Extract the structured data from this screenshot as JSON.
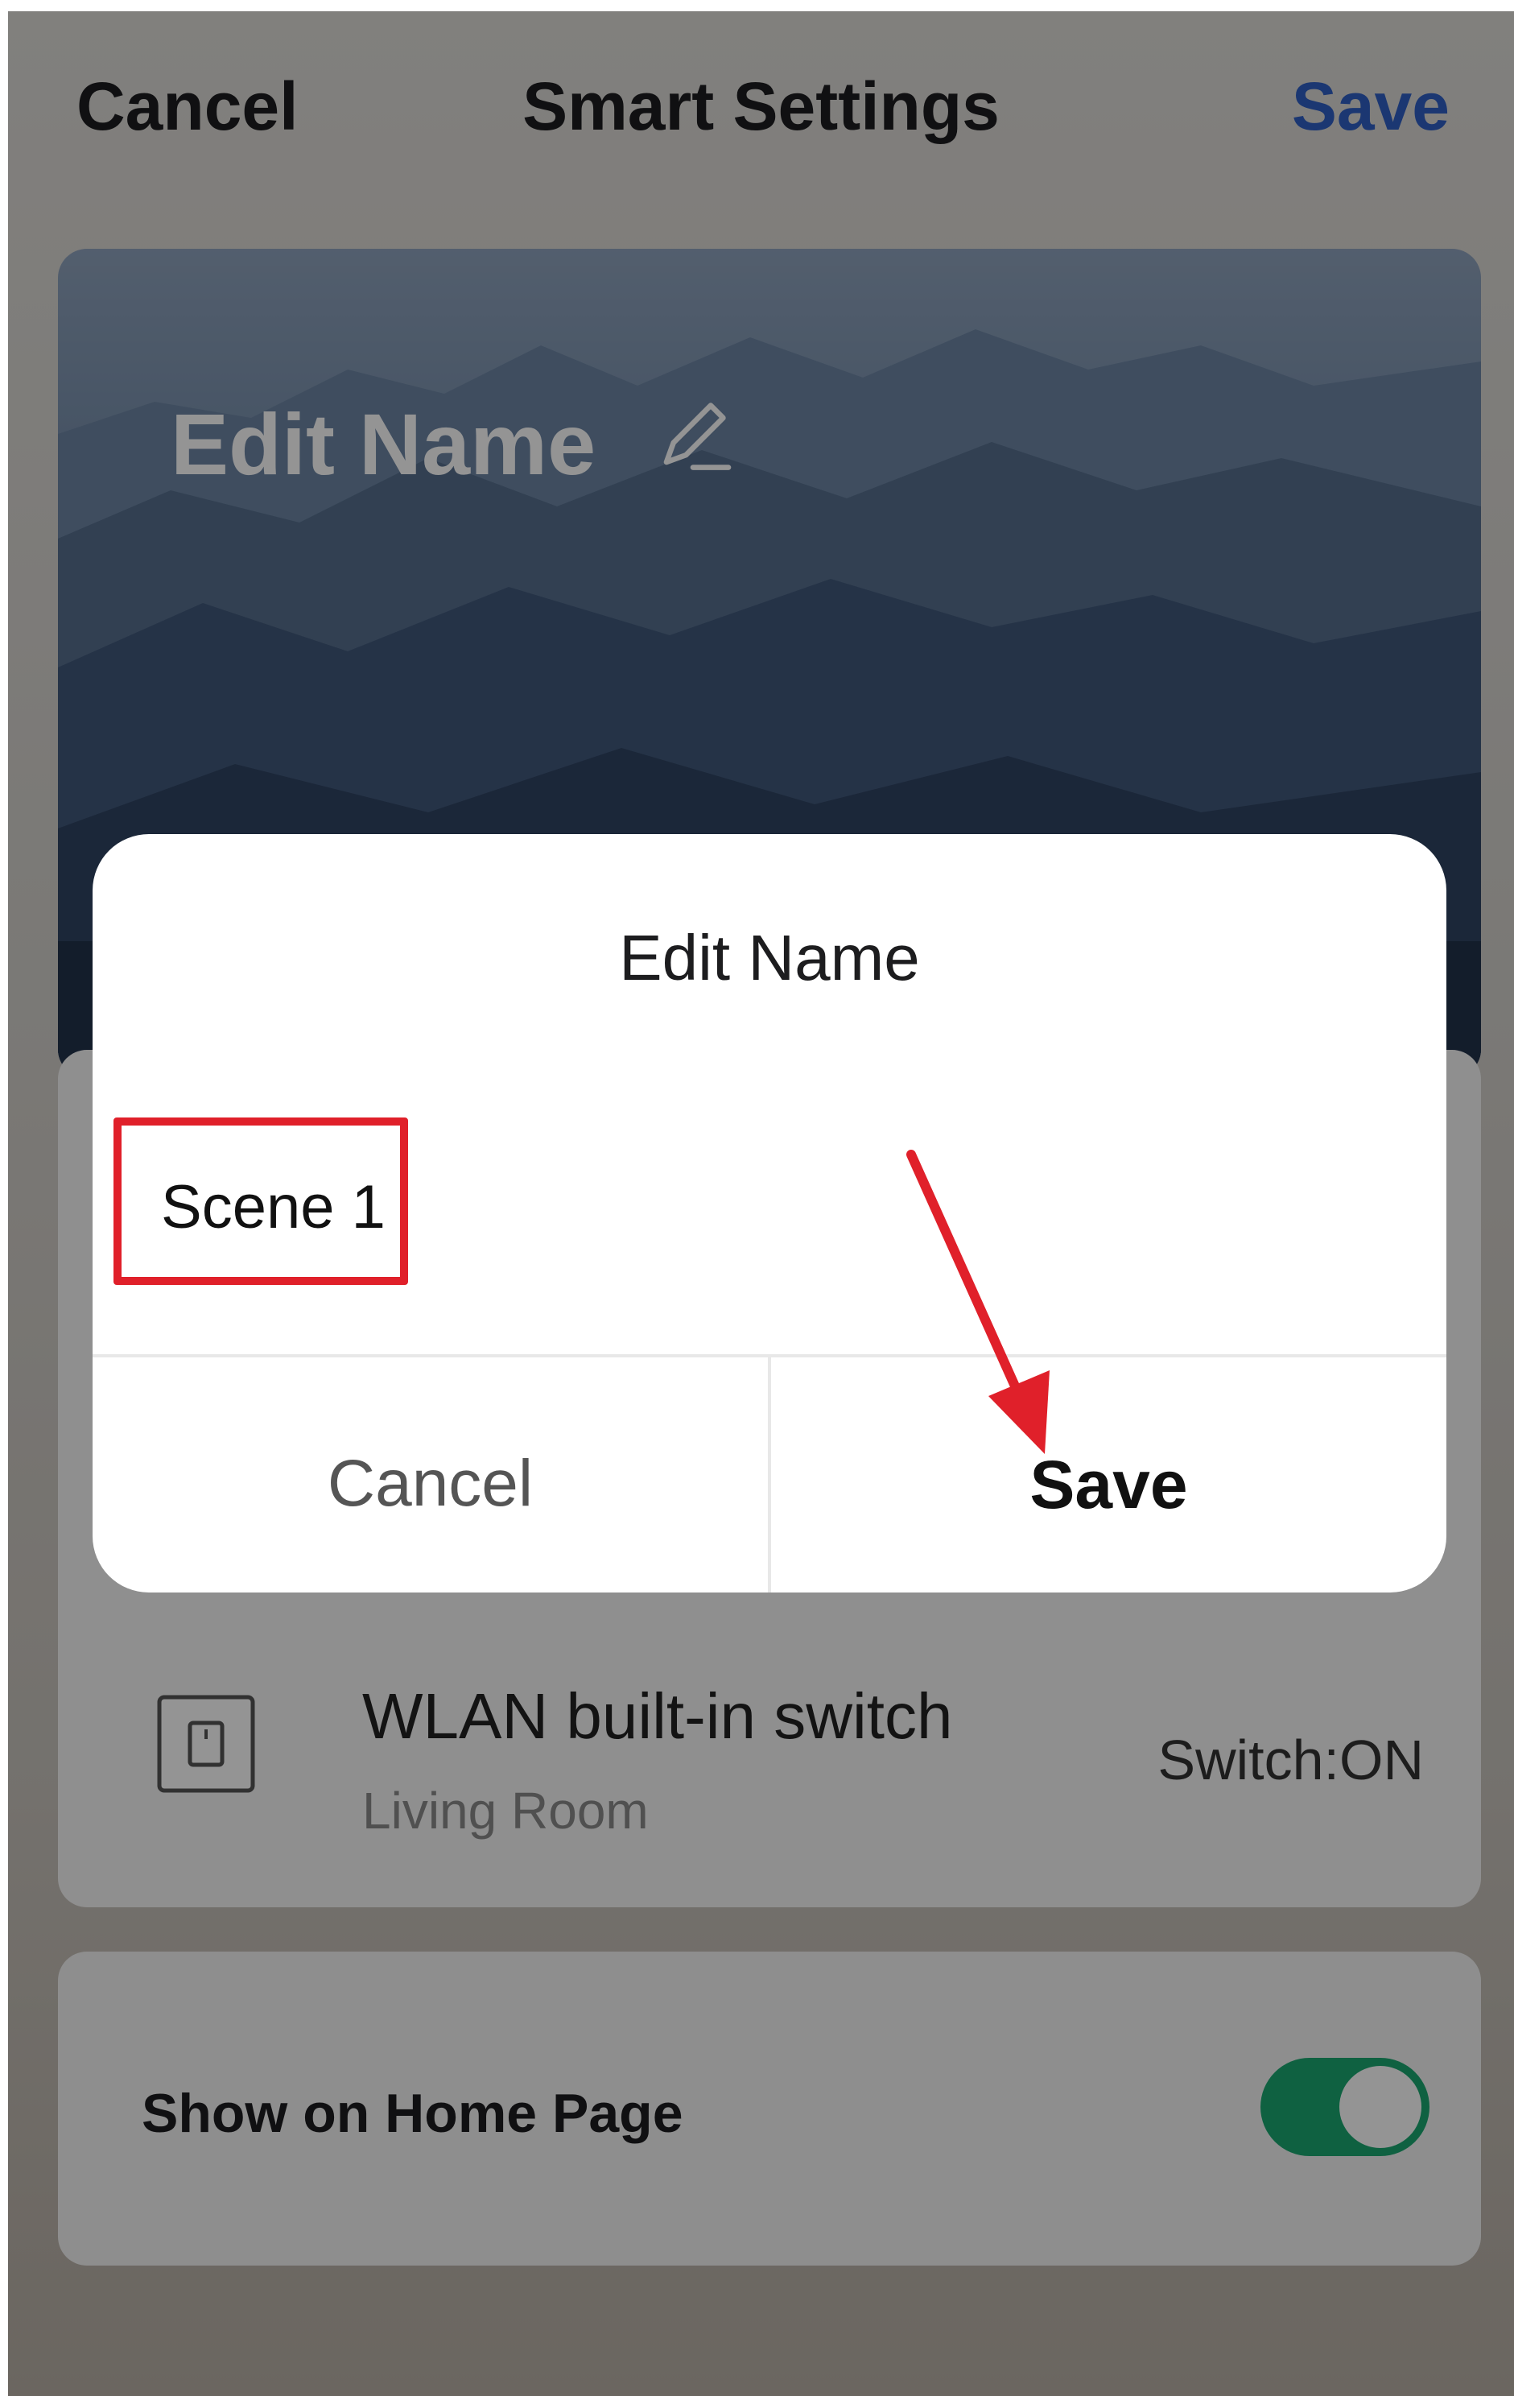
{
  "header": {
    "cancel_label": "Cancel",
    "title": "Smart Settings",
    "save_label": "Save"
  },
  "banner": {
    "name_placeholder": "Edit Name",
    "pencil_icon": "pencil-icon"
  },
  "action": {
    "device_name": "WLAN built-in switch",
    "room": "Living Room",
    "state": "Switch:ON",
    "icon": "wall-switch-icon"
  },
  "home_page": {
    "label": "Show on Home Page",
    "enabled": true
  },
  "dialog": {
    "title": "Edit Name",
    "input_value": "Scene 1",
    "cancel_label": "Cancel",
    "save_label": "Save"
  },
  "colors": {
    "accent_blue": "#2f5fc4",
    "toggle_green": "#1aa870",
    "annotation_red": "#e0202a"
  }
}
